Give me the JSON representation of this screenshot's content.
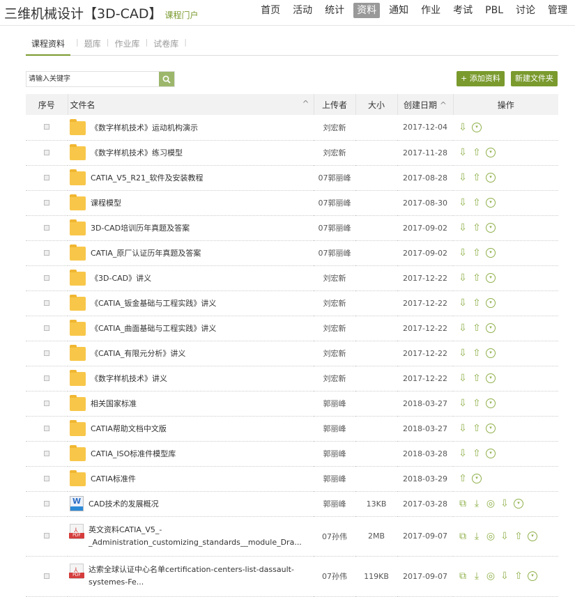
{
  "header": {
    "title": "三维机械设计【3D-CAD】",
    "subtitle": "课程门户",
    "nav": [
      {
        "label": "首页"
      },
      {
        "label": "活动"
      },
      {
        "label": "统计"
      },
      {
        "label": "资料",
        "active": true
      },
      {
        "label": "通知"
      },
      {
        "label": "作业"
      },
      {
        "label": "考试"
      },
      {
        "label": "PBL"
      },
      {
        "label": "讨论"
      },
      {
        "label": "管理"
      }
    ]
  },
  "subtabs": [
    {
      "label": "课程资料",
      "active": true
    },
    {
      "label": "题库"
    },
    {
      "label": "作业库"
    },
    {
      "label": "试卷库"
    }
  ],
  "search": {
    "placeholder": "请输入关键字"
  },
  "buttons": {
    "add": "+ 添加资料",
    "new_folder": "新建文件夹"
  },
  "table": {
    "headers": {
      "index": "序号",
      "name": "文件名",
      "uploader": "上传者",
      "size": "大小",
      "date": "创建日期",
      "actions": "操作"
    },
    "sort_icon": "^",
    "rows": [
      {
        "type": "folder",
        "name": "《数字样机技术》运动机构演示",
        "uploader": "刘宏新",
        "size": "",
        "date": "2017-12-04",
        "actions": [
          "down",
          "menu"
        ]
      },
      {
        "type": "folder",
        "name": "《数字样机技术》练习模型",
        "uploader": "刘宏新",
        "size": "",
        "date": "2017-11-28",
        "actions": [
          "down",
          "up",
          "menu"
        ]
      },
      {
        "type": "folder",
        "name": "CATIA_V5_R21_软件及安装教程",
        "uploader": "07郭丽峰",
        "size": "",
        "date": "2017-08-28",
        "actions": [
          "down",
          "up",
          "menu"
        ]
      },
      {
        "type": "folder",
        "name": "课程模型",
        "uploader": "07郭丽峰",
        "size": "",
        "date": "2017-08-30",
        "actions": [
          "down",
          "up",
          "menu"
        ]
      },
      {
        "type": "folder",
        "name": "3D-CAD培训历年真题及答案",
        "uploader": "07郭丽峰",
        "size": "",
        "date": "2017-09-02",
        "actions": [
          "down",
          "up",
          "menu"
        ]
      },
      {
        "type": "folder",
        "name": "CATIA_原厂认证历年真题及答案",
        "uploader": "07郭丽峰",
        "size": "",
        "date": "2017-09-02",
        "actions": [
          "down",
          "up",
          "menu"
        ]
      },
      {
        "type": "folder",
        "name": "《3D-CAD》讲义",
        "uploader": "刘宏新",
        "size": "",
        "date": "2017-12-22",
        "actions": [
          "down",
          "up",
          "menu"
        ]
      },
      {
        "type": "folder",
        "name": "《CATIA_钣金基础与工程实践》讲义",
        "uploader": "刘宏新",
        "size": "",
        "date": "2017-12-22",
        "actions": [
          "down",
          "up",
          "menu"
        ]
      },
      {
        "type": "folder",
        "name": "《CATIA_曲面基础与工程实践》讲义",
        "uploader": "刘宏新",
        "size": "",
        "date": "2017-12-22",
        "actions": [
          "down",
          "up",
          "menu"
        ]
      },
      {
        "type": "folder",
        "name": "《CATIA_有限元分析》讲义",
        "uploader": "刘宏新",
        "size": "",
        "date": "2017-12-22",
        "actions": [
          "down",
          "up",
          "menu"
        ]
      },
      {
        "type": "folder",
        "name": "《数字样机技术》讲义",
        "uploader": "刘宏新",
        "size": "",
        "date": "2017-12-22",
        "actions": [
          "down",
          "up",
          "menu"
        ]
      },
      {
        "type": "folder",
        "name": "相关国家标准",
        "uploader": "郭丽峰",
        "size": "",
        "date": "2018-03-27",
        "actions": [
          "down",
          "up",
          "menu"
        ]
      },
      {
        "type": "folder",
        "name": "CATIA帮助文档中文版",
        "uploader": "郭丽峰",
        "size": "",
        "date": "2018-03-27",
        "actions": [
          "down",
          "up",
          "menu"
        ]
      },
      {
        "type": "folder",
        "name": "CATIA_ISO标准件模型库",
        "uploader": "郭丽峰",
        "size": "",
        "date": "2018-03-28",
        "actions": [
          "down",
          "up",
          "menu"
        ]
      },
      {
        "type": "folder",
        "name": "CATIA标准件",
        "uploader": "郭丽峰",
        "size": "",
        "date": "2018-03-29",
        "actions": [
          "up",
          "menu"
        ]
      },
      {
        "type": "word",
        "name": "CAD技术的发展概况",
        "uploader": "郭丽峰",
        "size": "13KB",
        "date": "2017-03-28",
        "actions": [
          "copy",
          "download",
          "view",
          "down",
          "menu"
        ]
      },
      {
        "type": "pdf",
        "name": "英文资料CATIA_V5_-_Administration_customizing_standards__module_Dra...",
        "uploader": "07孙伟",
        "size": "2MB",
        "date": "2017-09-07",
        "actions": [
          "copy",
          "download",
          "view",
          "down",
          "up",
          "menu"
        ]
      },
      {
        "type": "pdf",
        "name": "达索全球认证中心名单certification-centers-list-dassault-systemes-Fe...",
        "uploader": "07孙伟",
        "size": "119KB",
        "date": "2017-09-07",
        "actions": [
          "copy",
          "download",
          "view",
          "down",
          "up",
          "menu"
        ]
      }
    ]
  },
  "colors": {
    "accent": "#7a9a2e",
    "icon": "#8fb04a"
  }
}
